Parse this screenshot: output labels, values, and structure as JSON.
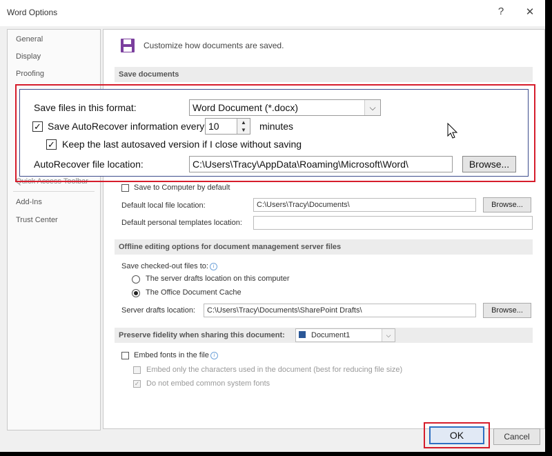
{
  "window": {
    "title": "Word Options",
    "help": "?",
    "close": "✕"
  },
  "nav": {
    "items": [
      "General",
      "Display",
      "Proofing",
      "Add-Ins",
      "Trust Center"
    ],
    "partial_label": "Quick Access Toolbar"
  },
  "header": {
    "text": "Customize how documents are saved."
  },
  "save_documents": {
    "section_title": "Save documents",
    "format_label": "Save files in this format:",
    "format_value": "Word Document (*.docx)",
    "autorecover_label": "Save AutoRecover information every",
    "autorecover_checked": true,
    "autorecover_minutes": "10",
    "minutes_label": "minutes",
    "keep_label": "Keep the last autosaved version if I close without saving",
    "keep_checked": true,
    "location_label": "AutoRecover file location:",
    "location_value": "C:\\Users\\Tracy\\AppData\\Roaming\\Microsoft\\Word\\",
    "browse_label": "Browse..."
  },
  "local": {
    "save_to_computer_label": "Save to Computer by default",
    "default_local_label": "Default local file location:",
    "default_local_value": "C:\\Users\\Tracy\\Documents\\",
    "browse_label": "Browse...",
    "personal_templates_label": "Default personal templates location:",
    "personal_templates_value": ""
  },
  "offline": {
    "section_title": "Offline editing options for document management server files",
    "checked_out_label": "Save checked-out files to:",
    "radio1_label": "The server drafts location on this computer",
    "radio2_label": "The Office Document Cache",
    "server_drafts_label": "Server drafts location:",
    "server_drafts_value": "C:\\Users\\Tracy\\Documents\\SharePoint Drafts\\",
    "browse_label": "Browse..."
  },
  "fidelity": {
    "section_title": "Preserve fidelity when sharing this document:",
    "document_value": "Document1",
    "embed_label": "Embed fonts in the file",
    "embed_only_label": "Embed only the characters used in the document (best for reducing file size)",
    "no_common_label": "Do not embed common system fonts"
  },
  "footer": {
    "ok_label": "OK",
    "cancel_label": "Cancel"
  },
  "colors": {
    "highlight": "#d61c2b",
    "accent": "#2d6fc2",
    "icon": "#7b3f9e"
  },
  "icons": {
    "save": "floppy-disk",
    "info": "info-circle",
    "dropdown": "chevron-down"
  }
}
